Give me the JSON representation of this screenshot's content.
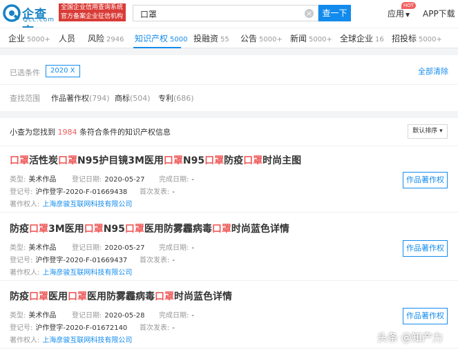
{
  "header": {
    "logo_name": "企查查",
    "logo_domain": "Qcc.com",
    "badge_line1": "全国企业信用查询系统",
    "badge_line2": "官方备案企业征信机构",
    "search_value": "口罩",
    "search_button": "查一下",
    "app_label": "应用",
    "hot_badge": "HOT",
    "download_label": "APP下载"
  },
  "nav": [
    {
      "label": "企业",
      "count": "5000+"
    },
    {
      "label": "人员",
      "count": ""
    },
    {
      "label": "风险",
      "count": "2946"
    },
    {
      "label": "知识产权",
      "count": "5000"
    },
    {
      "label": "投融资",
      "count": "55"
    },
    {
      "label": "公告",
      "count": "5000+"
    },
    {
      "label": "新闻",
      "count": "5000+"
    },
    {
      "label": "全球企业",
      "count": "16"
    },
    {
      "label": "招投标",
      "count": "5000+"
    }
  ],
  "filters": {
    "selected_label": "已选条件",
    "selected_tag": "2020",
    "tag_close": "X",
    "clear_all": "全部清除",
    "scope_label": "查找范围",
    "options": [
      {
        "label": "作品著作权",
        "count": "(794)"
      },
      {
        "label": "商标",
        "count": "(504)"
      },
      {
        "label": "专利",
        "count": "(686)"
      }
    ]
  },
  "results": {
    "prefix": "小查为您找到",
    "count": "1984",
    "suffix": "条符合条件的知识产权信息",
    "sort_label": "默认排序",
    "labels": {
      "type": "类型:",
      "reg_date": "登记日期:",
      "finish_date": "完成日期:",
      "reg_no": "登记号:",
      "first_pub": "首次发表:",
      "owner": "著作权人:"
    },
    "items": [
      {
        "title_parts": [
          {
            "t": "口罩",
            "hl": true
          },
          {
            "t": "活性炭",
            "hl": false
          },
          {
            "t": "口罩",
            "hl": true
          },
          {
            "t": "N95护目镜3M医用",
            "hl": false
          },
          {
            "t": "口罩",
            "hl": true
          },
          {
            "t": "N95",
            "hl": false
          },
          {
            "t": "口罩",
            "hl": true
          },
          {
            "t": "防疫",
            "hl": false
          },
          {
            "t": "口罩",
            "hl": true
          },
          {
            "t": "时尚主图",
            "hl": false
          }
        ],
        "type": "美术作品",
        "reg_date": "2020-05-27",
        "finish_date": "-",
        "reg_no": "沪作登字-2020-F-01669438",
        "first_pub": "-",
        "owner": "上海彦骏互联网科技有限公司",
        "button": "作品著作权"
      },
      {
        "title_parts": [
          {
            "t": "防疫",
            "hl": false
          },
          {
            "t": "口罩",
            "hl": true
          },
          {
            "t": "3M医用",
            "hl": false
          },
          {
            "t": "口罩",
            "hl": true
          },
          {
            "t": "N95",
            "hl": false
          },
          {
            "t": "口罩",
            "hl": true
          },
          {
            "t": "医用防雾霾病毒",
            "hl": false
          },
          {
            "t": "口罩",
            "hl": true
          },
          {
            "t": "时尚蓝色详情",
            "hl": false
          }
        ],
        "type": "美术作品",
        "reg_date": "2020-05-27",
        "finish_date": "-",
        "reg_no": "沪作登字-2020-F-01669437",
        "first_pub": "-",
        "owner": "上海彦骏互联网科技有限公司",
        "button": "作品著作权"
      },
      {
        "title_parts": [
          {
            "t": "防疫",
            "hl": false
          },
          {
            "t": "口罩",
            "hl": true
          },
          {
            "t": "医用",
            "hl": false
          },
          {
            "t": "口罩",
            "hl": true
          },
          {
            "t": "医用防雾霾病毒",
            "hl": false
          },
          {
            "t": "口罩",
            "hl": true
          },
          {
            "t": "时尚蓝色详情",
            "hl": false
          }
        ],
        "type": "美术作品",
        "reg_date": "2020-05-28",
        "finish_date": "-",
        "reg_no": "沪作登字-2020-F-01672140",
        "first_pub": "-",
        "owner": "上海彦骏互联网科技有限公司",
        "button": "作品著作权"
      }
    ]
  },
  "watermark": "头条 @知产力",
  "colors": {
    "accent": "#128bed",
    "highlight": "#ee5a5a",
    "badge_red": "#d93b36"
  }
}
